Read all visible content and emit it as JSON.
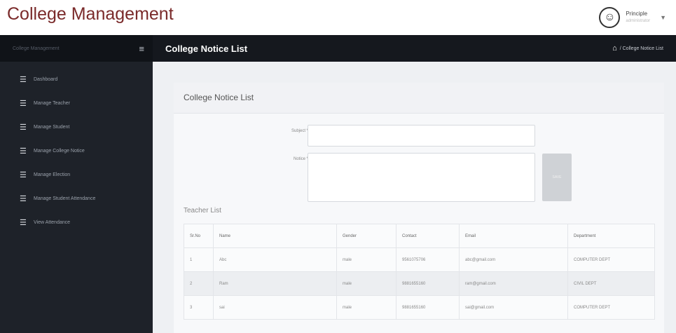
{
  "app": {
    "title": "College Management"
  },
  "user": {
    "name": "Principle",
    "role": "administrator",
    "avatar_icon": "user-circle-icon"
  },
  "sidebar": {
    "app_label": "College Management",
    "items": [
      {
        "label": "Dashboard",
        "icon": "menu-icon"
      },
      {
        "label": "Manage Teacher",
        "icon": "menu-icon"
      },
      {
        "label": "Manage Student",
        "icon": "menu-icon"
      },
      {
        "label": "Manage College Notice",
        "icon": "menu-icon"
      },
      {
        "label": "Manage Election",
        "icon": "menu-icon"
      },
      {
        "label": "Manage Student Attendance",
        "icon": "menu-icon"
      },
      {
        "label": "View Attendance",
        "icon": "menu-icon"
      }
    ]
  },
  "header": {
    "title": "College Notice List",
    "breadcrumb": "/ College Notice List"
  },
  "form": {
    "title": "College Notice List",
    "subject_label": "Subject *",
    "notice_label": "Notice *",
    "subject_value": "",
    "notice_value": "",
    "save_label": "SAVE"
  },
  "teacher_list": {
    "title": "Teacher List",
    "columns": [
      "Sr.No",
      "Name",
      "Gender",
      "Contact",
      "Email",
      "Department"
    ],
    "rows": [
      [
        "1",
        "Abc",
        "male",
        "9561075706",
        "abc@gmail.com",
        "COMPUTER DEPT"
      ],
      [
        "2",
        "Ram",
        "male",
        "9881655160",
        "ram@gmail.com",
        "CIVIL DEPT"
      ],
      [
        "3",
        "sai",
        "male",
        "9881655160",
        "sai@gmail.com",
        "COMPUTER DEPT"
      ]
    ]
  },
  "colors": {
    "brand": "#7a2a2a",
    "sidebar": "#1e2229",
    "header": "#15181e"
  }
}
